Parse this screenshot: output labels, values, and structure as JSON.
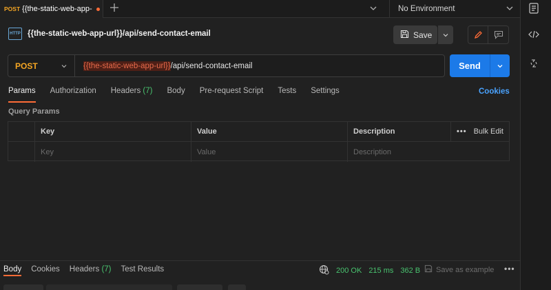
{
  "tab": {
    "method": "POST",
    "name": "{{the-static-web-app-",
    "unsaved_color": "#ff6c37"
  },
  "environment": {
    "selected": "No Environment"
  },
  "request": {
    "title": "{{the-static-web-app-url}}/api/send-contact-email",
    "icon_label": "HTTP",
    "method": "POST",
    "url_variable": "{{the-static-web-app-url}}",
    "url_path": "/api/send-contact-email"
  },
  "toolbar": {
    "save_label": "Save",
    "send_label": "Send"
  },
  "request_tabs": [
    {
      "label": "Params",
      "count": ""
    },
    {
      "label": "Authorization",
      "count": ""
    },
    {
      "label": "Headers",
      "count": "(7)"
    },
    {
      "label": "Body",
      "count": ""
    },
    {
      "label": "Pre-request Script",
      "count": ""
    },
    {
      "label": "Tests",
      "count": ""
    },
    {
      "label": "Settings",
      "count": ""
    }
  ],
  "cookies_link": "Cookies",
  "query_params": {
    "section_label": "Query Params",
    "columns": [
      "Key",
      "Value",
      "Description"
    ],
    "bulk_edit": "Bulk Edit",
    "more": "•••",
    "placeholders": {
      "key": "Key",
      "value": "Value",
      "description": "Description"
    }
  },
  "response": {
    "tabs": [
      {
        "label": "Body",
        "count": ""
      },
      {
        "label": "Cookies",
        "count": ""
      },
      {
        "label": "Headers",
        "count": "(7)"
      },
      {
        "label": "Test Results",
        "count": ""
      }
    ],
    "status": "200 OK",
    "time": "215 ms",
    "size": "362 B",
    "save_example": "Save as example",
    "more": "•••"
  },
  "colors": {
    "accent": "#ff6c37",
    "send_button": "#1c7ae8",
    "success": "#49c36f",
    "method_post": "#f5a623",
    "link": "#4aa3ff"
  },
  "icons": {
    "tab_add": "plus-icon",
    "environment_dropdown": "chevron-down-icon",
    "environment_panel": "environment-quicklook-icon",
    "save": "floppy-disk-icon",
    "edit": "pencil-icon",
    "comments": "comment-icon",
    "code": "code-icon",
    "sync": "refresh-icon",
    "network": "globe-icon"
  }
}
